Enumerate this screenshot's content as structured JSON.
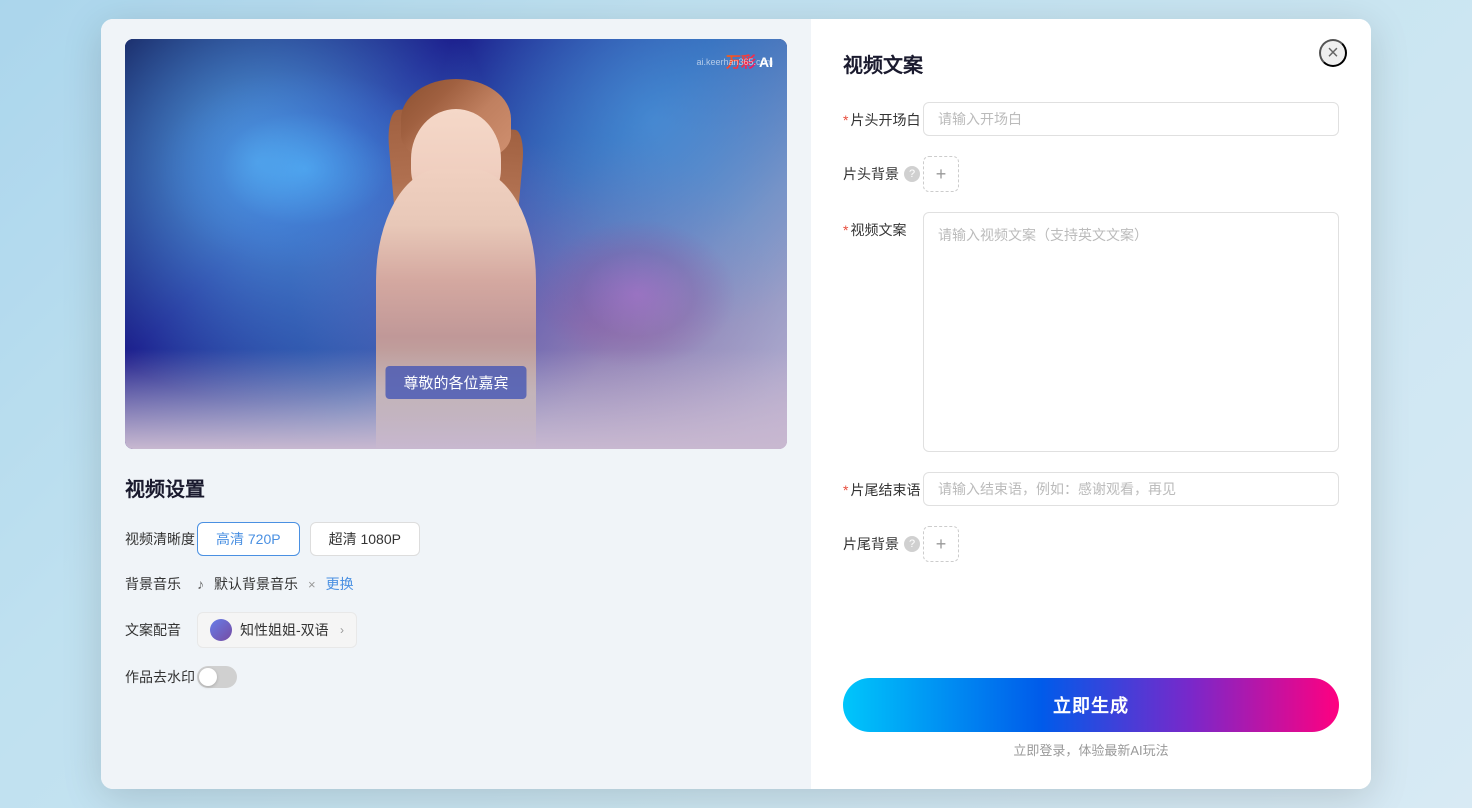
{
  "modal": {
    "close_label": "×"
  },
  "left": {
    "video_subtitle": "尊敬的各位嘉宾",
    "watermark_text": "万彩",
    "watermark_ai": "AI",
    "watermark_site": "ai.keerhan365.com",
    "settings_title": "视频设置",
    "resolution_label": "视频清晰度",
    "resolution_options": [
      {
        "label": "高清 720P",
        "active": true
      },
      {
        "label": "超清 1080P",
        "active": false
      }
    ],
    "music_label": "背景音乐",
    "music_note_icon": "♪",
    "music_name": "默认背景音乐",
    "music_delete_icon": "×",
    "music_change_label": "更换",
    "voice_label": "文案配音",
    "voice_name": "知性姐姐-双语",
    "voice_arrow": "›",
    "watermark_label": "作品去水印"
  },
  "right": {
    "panel_title": "视频文案",
    "opening_label": "片头开场白",
    "required_star": "*",
    "opening_placeholder": "请输入开场白",
    "header_bg_label": "片头背景",
    "help_icon_label": "?",
    "add_btn_label": "+",
    "content_label": "视频文案",
    "content_placeholder": "请输入视频文案（支持英文文案）",
    "ending_label": "片尾结束语",
    "ending_placeholder": "请输入结束语，例如：感谢观看，再见",
    "footer_bg_label": "片尾背景",
    "generate_btn_label": "立即生成",
    "generate_hint": "立即登录，体验最新AI玩法"
  }
}
